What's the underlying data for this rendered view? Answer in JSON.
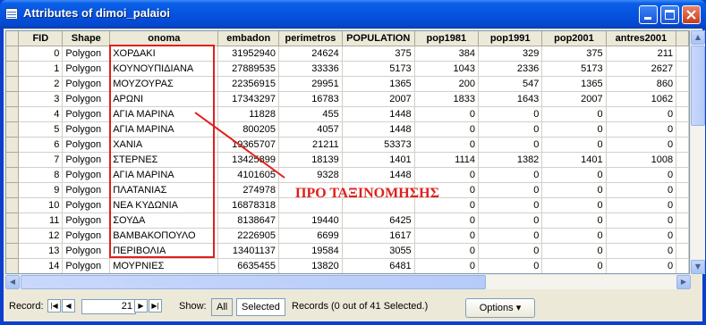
{
  "window": {
    "title": "Attributes of dimoi_palaioi",
    "minimize_label": "_",
    "maximize_label": "□",
    "close_label": "✕"
  },
  "table": {
    "columns": [
      "FID",
      "Shape",
      "onoma",
      "embadon",
      "perimetros",
      "POPULATION",
      "pop1981",
      "pop1991",
      "pop2001",
      "antres2001"
    ],
    "rows": [
      [
        "0",
        "Polygon",
        "ΧΟΡΔΑΚΙ",
        "31952940",
        "24624",
        "375",
        "384",
        "329",
        "375",
        "211"
      ],
      [
        "1",
        "Polygon",
        "ΚΟΥΝΟΥΠΙΔΙΑΝΑ",
        "27889535",
        "33336",
        "5173",
        "1043",
        "2336",
        "5173",
        "2627"
      ],
      [
        "2",
        "Polygon",
        "ΜΟΥΖΟΥΡΑΣ",
        "22356915",
        "29951",
        "1365",
        "200",
        "547",
        "1365",
        "860"
      ],
      [
        "3",
        "Polygon",
        "ΑΡΩΝΙ",
        "17343297",
        "16783",
        "2007",
        "1833",
        "1643",
        "2007",
        "1062"
      ],
      [
        "4",
        "Polygon",
        "ΑΓΙΑ ΜΑΡΙΝΑ",
        "11828",
        "455",
        "1448",
        "0",
        "0",
        "0",
        "0"
      ],
      [
        "5",
        "Polygon",
        "ΑΓΙΑ ΜΑΡΙΝΑ",
        "800205",
        "4057",
        "1448",
        "0",
        "0",
        "0",
        "0"
      ],
      [
        "6",
        "Polygon",
        "ΧΑΝΙΑ",
        "19365707",
        "21211",
        "53373",
        "0",
        "0",
        "0",
        "0"
      ],
      [
        "7",
        "Polygon",
        "ΣΤΕΡΝΕΣ",
        "13425899",
        "18139",
        "1401",
        "1114",
        "1382",
        "1401",
        "1008"
      ],
      [
        "8",
        "Polygon",
        "ΑΓΙΑ ΜΑΡΙΝΑ",
        "4101605",
        "9328",
        "1448",
        "0",
        "0",
        "0",
        "0"
      ],
      [
        "9",
        "Polygon",
        "ΠΛΑΤΑΝΙΑΣ",
        "274978",
        "",
        "",
        "0",
        "0",
        "0",
        "0"
      ],
      [
        "10",
        "Polygon",
        "ΝΕΑ ΚΥΔΩΝΙΑ",
        "16878318",
        "",
        "",
        "0",
        "0",
        "0",
        "0"
      ],
      [
        "11",
        "Polygon",
        "ΣΟΥΔΑ",
        "8138647",
        "19440",
        "6425",
        "0",
        "0",
        "0",
        "0"
      ],
      [
        "12",
        "Polygon",
        "ΒΑΜΒΑΚΟΠΟΥΛΟ",
        "2226905",
        "6699",
        "1617",
        "0",
        "0",
        "0",
        "0"
      ],
      [
        "13",
        "Polygon",
        "ΠΕΡΙΒΟΛΙΑ",
        "13401137",
        "19584",
        "3055",
        "0",
        "0",
        "0",
        "0"
      ],
      [
        "14",
        "Polygon",
        "ΜΟΥΡΝΙΕΣ",
        "6635455",
        "13820",
        "6481",
        "0",
        "0",
        "0",
        "0"
      ]
    ]
  },
  "annotation": {
    "text": "ΠΡΟ ΤΑΞΙΝΟΜΗΣΗΣ",
    "color": "#e0201c"
  },
  "statusbar": {
    "record_label": "Record:",
    "record_value": "21",
    "show_label": "Show:",
    "all_label": "All",
    "selected_label": "Selected",
    "records_text": "Records  (0 out of 41 Selected.)",
    "options_label": "Options"
  },
  "colors": {
    "titlebar": "#0553e0",
    "window_bg": "#ece9d8",
    "annotation": "#e0201c"
  }
}
